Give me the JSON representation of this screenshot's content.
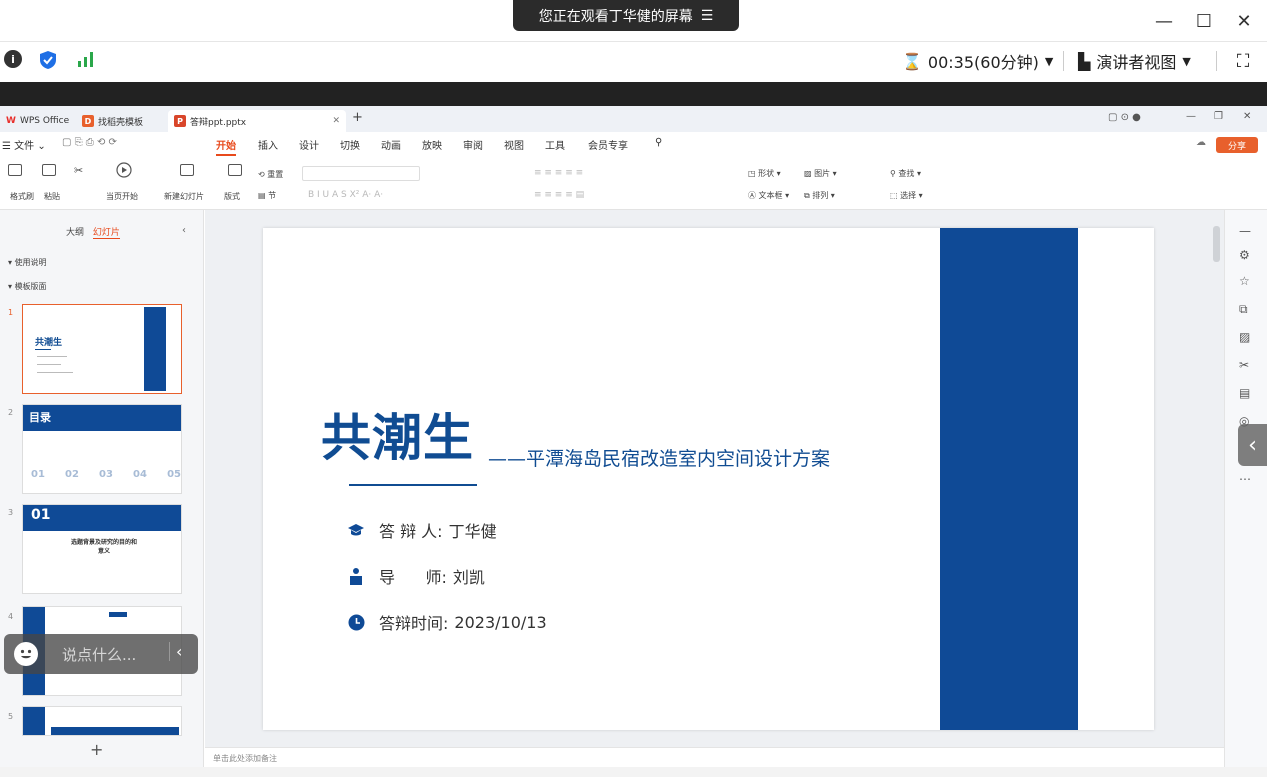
{
  "meeting": {
    "share_banner": "您正在观看丁华健的屏幕",
    "timer": "00:35(60分钟)",
    "presenter_view": "演讲者视图"
  },
  "wps": {
    "tabs": [
      {
        "label": "WPS Office"
      },
      {
        "label": "找稻壳模板"
      },
      {
        "label": "答辩ppt.pptx"
      }
    ],
    "menu": [
      "文件",
      "开始",
      "插入",
      "设计",
      "切换",
      "动画",
      "放映",
      "审阅",
      "视图",
      "工具",
      "会员专享"
    ],
    "active_menu": "开始",
    "share_label": "分享",
    "ribbon": {
      "format_painter": "格式刷",
      "paste": "粘贴",
      "play_from_current": "当页开始",
      "new_slide": "新建幻灯片",
      "layout": "版式",
      "reset": "重置",
      "section": "节",
      "shape": "形状",
      "picture": "图片",
      "textbox": "文本框",
      "arrange": "排列",
      "find": "查找",
      "select": "选择"
    }
  },
  "left_panel": {
    "tab_outline": "大纲",
    "tab_slides": "幻灯片",
    "section_usage": "使用说明",
    "section_template": "模板版面",
    "slide_numbers": [
      "1",
      "2",
      "3",
      "4",
      "5"
    ],
    "thumb1_title": "共潮生",
    "thumb2_title": "目录",
    "thumb2_nums": [
      "01",
      "02",
      "03",
      "04",
      "05"
    ],
    "thumb3_num": "01",
    "thumb3_title": "选题背景及研究的目的和意义"
  },
  "chat": {
    "placeholder": "说点什么..."
  },
  "slide": {
    "title": "共潮生",
    "subtitle": "——平潭海岛民宿改造室内空间设计方案",
    "defender_label": "答 辩 人:",
    "defender": "丁华健",
    "advisor_label": "导      师:",
    "advisor": "刘凯",
    "date_label": "答辩时间:",
    "date": "2023/10/13",
    "accent_color": "#0f4a96"
  },
  "notes_placeholder": "单击此处添加备注"
}
